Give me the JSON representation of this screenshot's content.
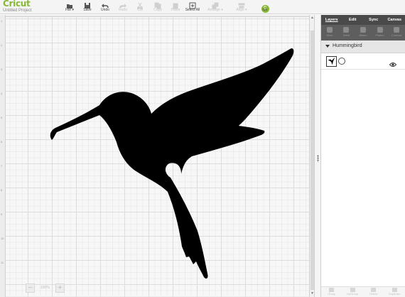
{
  "brand": {
    "logo": "Cricut",
    "project": "Untitled Project"
  },
  "toolbar": [
    {
      "label": "File ▾",
      "icon": "folder-icon",
      "enabled": true
    },
    {
      "label": "Save",
      "icon": "save-icon",
      "enabled": true
    },
    {
      "label": "Undo",
      "icon": "undo-icon",
      "enabled": true
    },
    {
      "label": "Redo",
      "icon": "redo-icon",
      "enabled": false
    },
    {
      "label": "Cut",
      "icon": "cut-icon",
      "enabled": false
    },
    {
      "label": "Copy",
      "icon": "copy-icon",
      "enabled": false
    },
    {
      "label": "Paste",
      "icon": "paste-icon",
      "enabled": false
    },
    {
      "label": "Select All",
      "icon": "select-all-icon",
      "enabled": true
    },
    {
      "label": "Arrange ▾",
      "icon": "arrange-icon",
      "enabled": false
    },
    {
      "label": "Align ▾",
      "icon": "align-icon",
      "enabled": false
    },
    {
      "label": "Go",
      "icon": "go-icon",
      "enabled": true,
      "go_letter": "C"
    }
  ],
  "ruler_labels": [
    "1",
    "2",
    "3",
    "4",
    "5",
    "6",
    "7",
    "8",
    "9",
    "10",
    "11"
  ],
  "zoom": {
    "minus": "−",
    "value": "100%",
    "plus": "+"
  },
  "panel": {
    "tabs": [
      "Layers",
      "Edit",
      "Sync",
      "Canvas"
    ],
    "tools": [
      "Slice",
      "Weld",
      "Attach",
      "Flatten",
      "Contour"
    ],
    "group_name": "Hummingbird",
    "layer_visibility": "visible",
    "bottom_tools": [
      "Group",
      "UnGroup",
      "Delete",
      "Duplicate"
    ]
  },
  "colors": {
    "brand": "#86b832",
    "panel_header": "#4a4a4a",
    "shape": "#000000"
  }
}
